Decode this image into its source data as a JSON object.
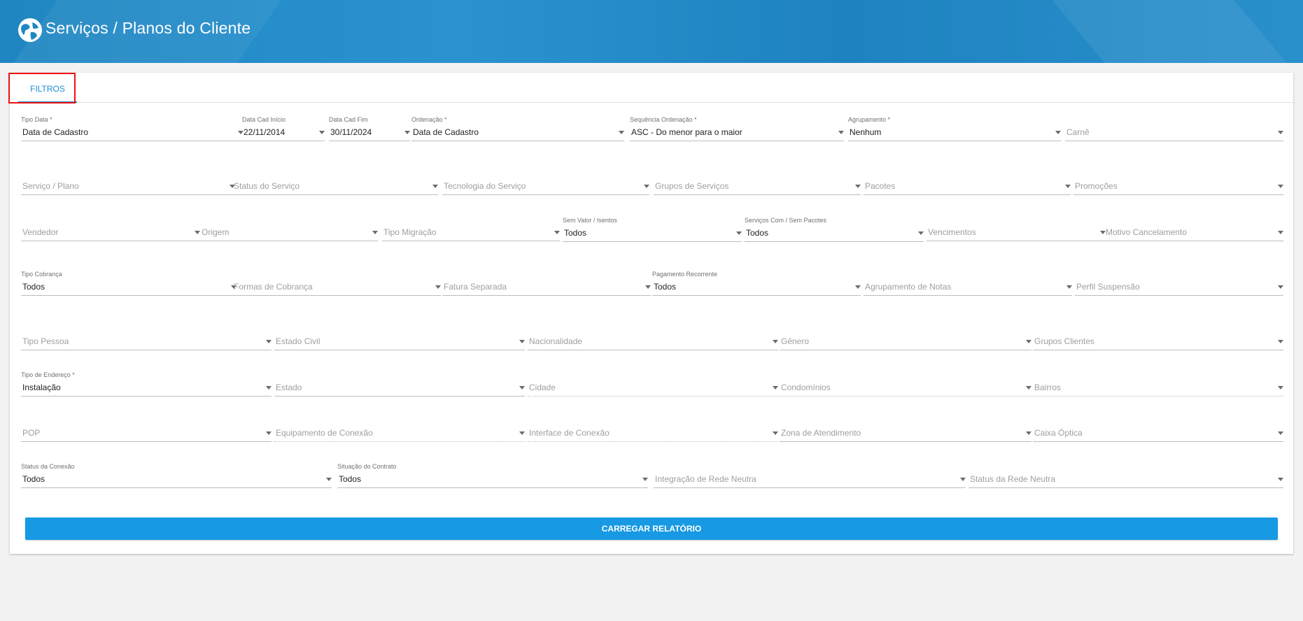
{
  "header": {
    "title": "Serviços / Planos do Cliente",
    "logo_icon": "globe-icon"
  },
  "tabs": [
    {
      "label": "FILTROS",
      "active": true
    }
  ],
  "filters": {
    "tipo_data": {
      "label": "Tipo Data *",
      "value": "Data de Cadastro"
    },
    "data_cad_inicio": {
      "label": "Data Cad Início",
      "value": "22/11/2014"
    },
    "data_cad_fim": {
      "label": "Data Cad Fim",
      "value": "30/11/2024"
    },
    "ordenacao": {
      "label": "Ordenação *",
      "value": "Data de Cadastro"
    },
    "sequencia_ordenacao": {
      "label": "Sequência Ordenação *",
      "value": "ASC - Do menor para o maior"
    },
    "agrupamento": {
      "label": "Agrupamento *",
      "value": "Nenhum"
    },
    "carne": {
      "placeholder": "Carnê"
    },
    "servico_plano": {
      "placeholder": "Serviço / Plano"
    },
    "status_servico": {
      "placeholder": "Status do Serviço"
    },
    "tecnologia_servico": {
      "placeholder": "Tecnologia do Serviço"
    },
    "grupos_servicos": {
      "placeholder": "Grupos de Serviços"
    },
    "pacotes": {
      "placeholder": "Pacotes"
    },
    "promocoes": {
      "placeholder": "Promoções"
    },
    "vendedor": {
      "placeholder": "Vendedor"
    },
    "origem": {
      "placeholder": "Origem"
    },
    "tipo_migracao": {
      "placeholder": "Tipo Migração"
    },
    "sem_valor": {
      "label": "Sem Valor / Isentos",
      "value": "Todos"
    },
    "servicos_pacotes": {
      "label": "Serviços Com / Sem Pacotes",
      "value": "Todos"
    },
    "vencimentos": {
      "placeholder": "Vencimentos"
    },
    "motivo_cancelamento": {
      "placeholder": "Motivo Cancelamento"
    },
    "tipo_cobranca": {
      "label": "Tipo Cobrança",
      "value": "Todos"
    },
    "formas_cobranca": {
      "placeholder": "Formas de Cobrança"
    },
    "fatura_separada": {
      "placeholder": "Fatura Separada"
    },
    "pagamento_recorrente": {
      "label": "Pagamento Recorrente",
      "value": "Todos"
    },
    "agrupamento_notas": {
      "placeholder": "Agrupamento de Notas"
    },
    "perfil_suspensao": {
      "placeholder": "Perfil Suspensão"
    },
    "tipo_pessoa": {
      "placeholder": "Tipo Pessoa"
    },
    "estado_civil": {
      "placeholder": "Estado Civil"
    },
    "nacionalidade": {
      "placeholder": "Nacionalidade"
    },
    "genero": {
      "placeholder": "Gênero"
    },
    "grupos_clientes": {
      "placeholder": "Grupos Clientes"
    },
    "tipo_endereco": {
      "label": "Tipo de Endereço *",
      "value": "Instalação"
    },
    "estado": {
      "placeholder": "Estado"
    },
    "cidade": {
      "placeholder": "Cidade"
    },
    "condominios": {
      "placeholder": "Condomínios"
    },
    "bairros": {
      "placeholder": "Bairros"
    },
    "pop": {
      "placeholder": "POP"
    },
    "equipamento_conexao": {
      "placeholder": "Equipamento de Conexão"
    },
    "interface_conexao": {
      "placeholder": "Interface de Conexão"
    },
    "zona_atendimento": {
      "placeholder": "Zona de Atendimento"
    },
    "caixa_optica": {
      "placeholder": "Caixa Óptica"
    },
    "status_conexao": {
      "label": "Status da Conexão",
      "value": "Todos"
    },
    "situacao_contrato": {
      "label": "Situação do Contrato",
      "value": "Todos"
    },
    "integracao_rede_neutra": {
      "placeholder": "Integração de Rede Neutra"
    },
    "status_rede_neutra": {
      "placeholder": "Status da Rede Neutra"
    }
  },
  "actions": {
    "load_report_label": "CARREGAR RELATÓRIO"
  },
  "colors": {
    "header": "#1f86c2",
    "accent": "#1a8fd6",
    "button": "#1799e3",
    "highlight": "#e11111"
  }
}
